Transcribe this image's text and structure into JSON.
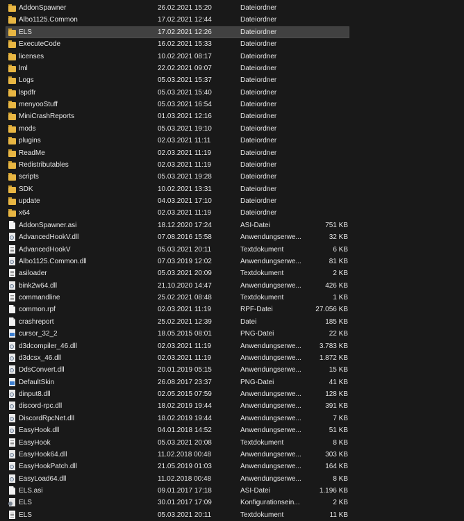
{
  "files": [
    {
      "name": "AddonSpawner",
      "date": "26.02.2021 15:20",
      "type": "Dateiordner",
      "size": "",
      "icon": "folder-icon"
    },
    {
      "name": "Albo1125.Common",
      "date": "17.02.2021 12:44",
      "type": "Dateiordner",
      "size": "",
      "icon": "folder-icon"
    },
    {
      "name": "ELS",
      "date": "17.02.2021 12:26",
      "type": "Dateiordner",
      "size": "",
      "icon": "folder-icon",
      "selected": true
    },
    {
      "name": "ExecuteCode",
      "date": "16.02.2021 15:33",
      "type": "Dateiordner",
      "size": "",
      "icon": "folder-icon"
    },
    {
      "name": "licenses",
      "date": "10.02.2021 08:17",
      "type": "Dateiordner",
      "size": "",
      "icon": "folder-icon"
    },
    {
      "name": "lml",
      "date": "22.02.2021 09:07",
      "type": "Dateiordner",
      "size": "",
      "icon": "folder-icon"
    },
    {
      "name": "Logs",
      "date": "05.03.2021 15:37",
      "type": "Dateiordner",
      "size": "",
      "icon": "folder-icon"
    },
    {
      "name": "lspdfr",
      "date": "05.03.2021 15:40",
      "type": "Dateiordner",
      "size": "",
      "icon": "folder-icon"
    },
    {
      "name": "menyooStuff",
      "date": "05.03.2021 16:54",
      "type": "Dateiordner",
      "size": "",
      "icon": "folder-icon"
    },
    {
      "name": "MiniCrashReports",
      "date": "01.03.2021 12:16",
      "type": "Dateiordner",
      "size": "",
      "icon": "folder-icon"
    },
    {
      "name": "mods",
      "date": "05.03.2021 19:10",
      "type": "Dateiordner",
      "size": "",
      "icon": "folder-icon"
    },
    {
      "name": "plugins",
      "date": "02.03.2021 11:11",
      "type": "Dateiordner",
      "size": "",
      "icon": "folder-icon"
    },
    {
      "name": "ReadMe",
      "date": "02.03.2021 11:19",
      "type": "Dateiordner",
      "size": "",
      "icon": "folder-icon"
    },
    {
      "name": "Redistributables",
      "date": "02.03.2021 11:19",
      "type": "Dateiordner",
      "size": "",
      "icon": "folder-icon"
    },
    {
      "name": "scripts",
      "date": "05.03.2021 19:28",
      "type": "Dateiordner",
      "size": "",
      "icon": "folder-icon"
    },
    {
      "name": "SDK",
      "date": "10.02.2021 13:31",
      "type": "Dateiordner",
      "size": "",
      "icon": "folder-icon"
    },
    {
      "name": "update",
      "date": "04.03.2021 17:10",
      "type": "Dateiordner",
      "size": "",
      "icon": "folder-icon"
    },
    {
      "name": "x64",
      "date": "02.03.2021 11:19",
      "type": "Dateiordner",
      "size": "",
      "icon": "folder-icon"
    },
    {
      "name": "AddonSpawner.asi",
      "date": "18.12.2020 17:24",
      "type": "ASI-Datei",
      "size": "751 KB",
      "icon": "file-icon"
    },
    {
      "name": "AdvancedHookV.dll",
      "date": "07.08.2016 15:58",
      "type": "Anwendungserwe...",
      "size": "32 KB",
      "icon": "dll-icon"
    },
    {
      "name": "AdvancedHookV",
      "date": "05.03.2021 20:11",
      "type": "Textdokument",
      "size": "6 KB",
      "icon": "text-icon"
    },
    {
      "name": "Albo1125.Common.dll",
      "date": "07.03.2019 12:02",
      "type": "Anwendungserwe...",
      "size": "81 KB",
      "icon": "dll-icon"
    },
    {
      "name": "asiloader",
      "date": "05.03.2021 20:09",
      "type": "Textdokument",
      "size": "2 KB",
      "icon": "text-icon"
    },
    {
      "name": "bink2w64.dll",
      "date": "21.10.2020 14:47",
      "type": "Anwendungserwe...",
      "size": "426 KB",
      "icon": "dll-icon"
    },
    {
      "name": "commandline",
      "date": "25.02.2021 08:48",
      "type": "Textdokument",
      "size": "1 KB",
      "icon": "text-icon"
    },
    {
      "name": "common.rpf",
      "date": "02.03.2021 11:19",
      "type": "RPF-Datei",
      "size": "27.056 KB",
      "icon": "file-icon"
    },
    {
      "name": "crashreport",
      "date": "25.02.2021 12:39",
      "type": "Datei",
      "size": "185 KB",
      "icon": "file-icon"
    },
    {
      "name": "cursor_32_2",
      "date": "18.05.2015 08:01",
      "type": "PNG-Datei",
      "size": "22 KB",
      "icon": "image-icon"
    },
    {
      "name": "d3dcompiler_46.dll",
      "date": "02.03.2021 11:19",
      "type": "Anwendungserwe...",
      "size": "3.783 KB",
      "icon": "dll-icon"
    },
    {
      "name": "d3dcsx_46.dll",
      "date": "02.03.2021 11:19",
      "type": "Anwendungserwe...",
      "size": "1.872 KB",
      "icon": "dll-icon"
    },
    {
      "name": "DdsConvert.dll",
      "date": "20.01.2019 05:15",
      "type": "Anwendungserwe...",
      "size": "15 KB",
      "icon": "dll-icon"
    },
    {
      "name": "DefaultSkin",
      "date": "26.08.2017 23:37",
      "type": "PNG-Datei",
      "size": "41 KB",
      "icon": "image-icon"
    },
    {
      "name": "dinput8.dll",
      "date": "02.05.2015 07:59",
      "type": "Anwendungserwe...",
      "size": "128 KB",
      "icon": "dll-icon"
    },
    {
      "name": "discord-rpc.dll",
      "date": "18.02.2019 19:44",
      "type": "Anwendungserwe...",
      "size": "391 KB",
      "icon": "dll-icon"
    },
    {
      "name": "DiscordRpcNet.dll",
      "date": "18.02.2019 19:44",
      "type": "Anwendungserwe...",
      "size": "7 KB",
      "icon": "dll-icon"
    },
    {
      "name": "EasyHook.dll",
      "date": "04.01.2018 14:52",
      "type": "Anwendungserwe...",
      "size": "51 KB",
      "icon": "dll-icon"
    },
    {
      "name": "EasyHook",
      "date": "05.03.2021 20:08",
      "type": "Textdokument",
      "size": "8 KB",
      "icon": "text-icon"
    },
    {
      "name": "EasyHook64.dll",
      "date": "11.02.2018 00:48",
      "type": "Anwendungserwe...",
      "size": "303 KB",
      "icon": "dll-icon"
    },
    {
      "name": "EasyHookPatch.dll",
      "date": "21.05.2019 01:03",
      "type": "Anwendungserwe...",
      "size": "164 KB",
      "icon": "dll-icon"
    },
    {
      "name": "EasyLoad64.dll",
      "date": "11.02.2018 00:48",
      "type": "Anwendungserwe...",
      "size": "8 KB",
      "icon": "dll-icon"
    },
    {
      "name": "ELS.asi",
      "date": "09.01.2017 17:18",
      "type": "ASI-Datei",
      "size": "1.196 KB",
      "icon": "file-icon"
    },
    {
      "name": "ELS",
      "date": "30.01.2017 17:09",
      "type": "Konfigurationsein...",
      "size": "2 KB",
      "icon": "settings-icon"
    },
    {
      "name": "ELS",
      "date": "05.03.2021 20:11",
      "type": "Textdokument",
      "size": "11 KB",
      "icon": "text-icon"
    }
  ]
}
